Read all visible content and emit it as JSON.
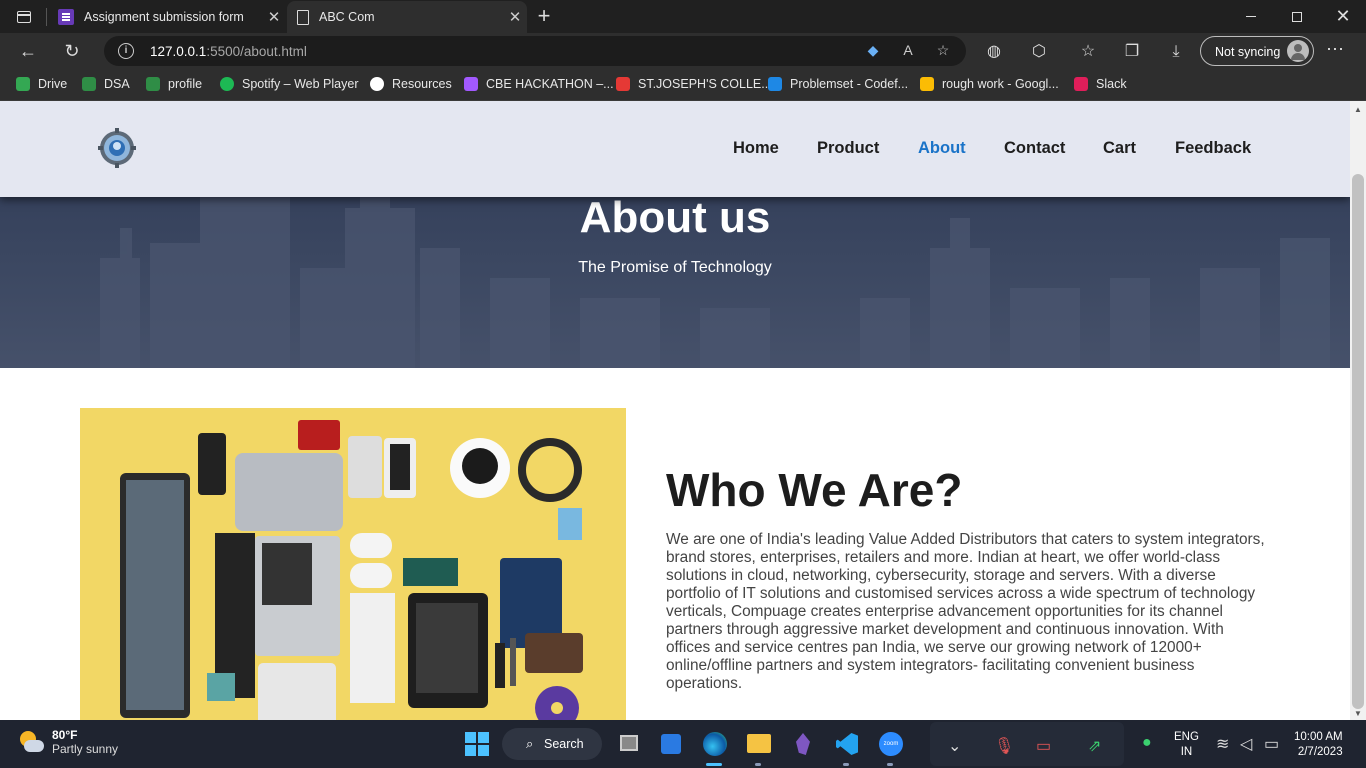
{
  "browser": {
    "tabs": [
      {
        "title": "Assignment submission form",
        "icon": "forms-icon"
      },
      {
        "title": "ABC Com",
        "icon": "page-icon"
      }
    ],
    "address": {
      "host": "127.0.0.1",
      "rest": ":5500/about.html"
    },
    "profile_label": "Not syncing",
    "bookmarks": [
      {
        "label": "Drive",
        "color": "#34a853"
      },
      {
        "label": "DSA",
        "color": "#2f8d46"
      },
      {
        "label": "profile",
        "color": "#2f8d46"
      },
      {
        "label": "Spotify – Web Player",
        "color": "#1db954"
      },
      {
        "label": "Resources",
        "color": "#ffffff"
      },
      {
        "label": "CBE HACKATHON –...",
        "color": "#a259ff"
      },
      {
        "label": "ST.JOSEPH'S COLLE...",
        "color": "#e53935"
      },
      {
        "label": "Problemset - Codef...",
        "color": "#1e88e5"
      },
      {
        "label": "rough work - Googl...",
        "color": "#fbbc04"
      },
      {
        "label": "Slack",
        "color": "#e01e5a"
      }
    ]
  },
  "site": {
    "nav": [
      "Home",
      "Product",
      "About",
      "Contact",
      "Cart",
      "Feedback"
    ],
    "active_nav": "About",
    "hero_title": "About us",
    "hero_subtitle": "The Promise of Technology",
    "section_title": "Who We Are?",
    "section_text": "We are one of India's leading Value Added Distributors that caters to system integrators, brand stores, enterprises, retailers and more. Indian at heart, we offer world-class solutions in cloud, networking, cybersecurity, storage and servers. With a diverse portfolio of IT solutions and customised services across a wide spectrum of technology verticals, Compuage creates enterprise advancement opportunities for its channel partners through aggressive market development and continuous innovation. With offices and service centres pan India, we serve our growing network of 12000+ online/offline partners and system integrators- facilitating convenient business operations.",
    "accent_color": "#1a73c8"
  },
  "taskbar": {
    "temperature": "80°F",
    "weather": "Partly sunny",
    "search_label": "Search",
    "lang_1": "ENG",
    "lang_2": "IN",
    "time": "10:00 AM",
    "date": "2/7/2023"
  }
}
